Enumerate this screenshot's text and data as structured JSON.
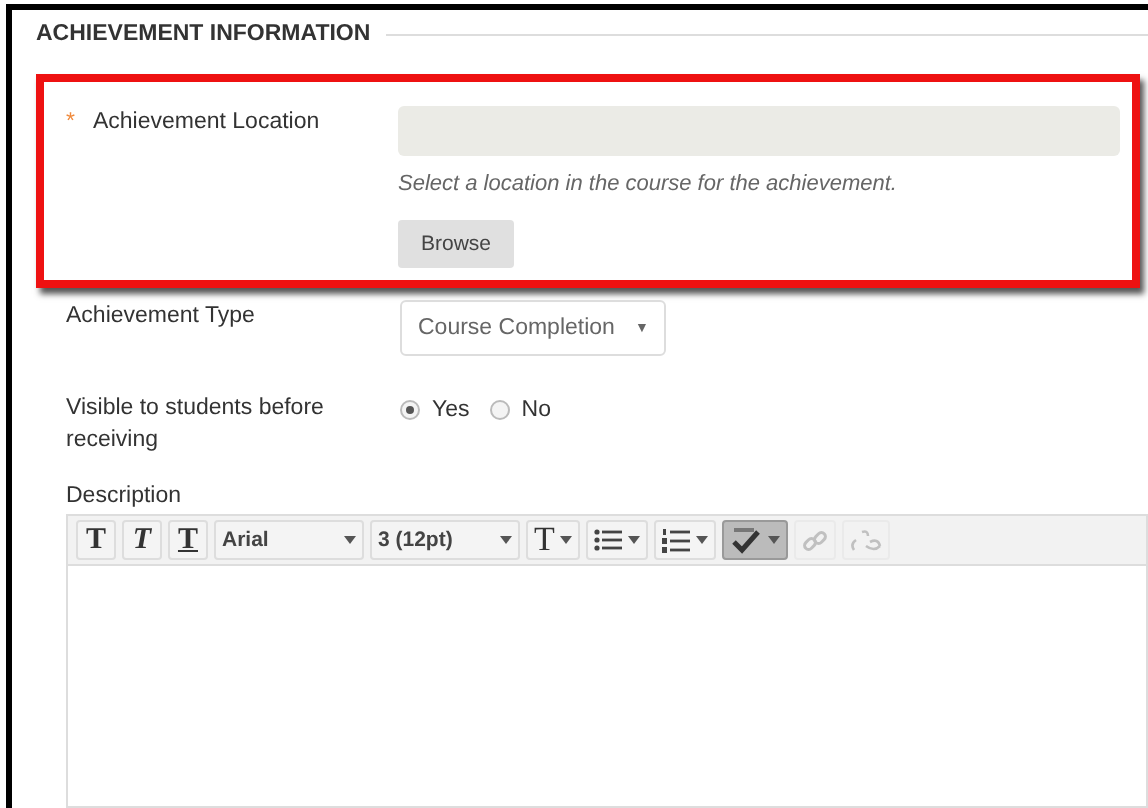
{
  "section": {
    "title": "ACHIEVEMENT INFORMATION"
  },
  "location": {
    "required_mark": "*",
    "label": "Achievement Location",
    "hint": "Select a location in the course for the achievement.",
    "button": "Browse",
    "highlighted": true
  },
  "type": {
    "label": "Achievement Type",
    "value": "Course Completion",
    "arrow": "▼"
  },
  "visible": {
    "label": "Visible to students before receiving",
    "options": [
      {
        "label": "Yes",
        "selected": true
      },
      {
        "label": "No",
        "selected": false
      }
    ]
  },
  "description": {
    "label": "Description",
    "toolbar": [
      {
        "kind": "bold",
        "label": "T",
        "pressed": false,
        "disabled": false
      },
      {
        "kind": "italic",
        "label": "T",
        "pressed": false,
        "disabled": false
      },
      {
        "kind": "underline",
        "label": "T",
        "pressed": false,
        "disabled": false
      },
      {
        "kind": "select",
        "label": "Arial",
        "pressed": false,
        "disabled": false
      },
      {
        "kind": "select",
        "label": "3 (12pt)",
        "pressed": false,
        "disabled": false
      },
      {
        "kind": "text-color",
        "label": "T",
        "pressed": false,
        "disabled": false
      },
      {
        "kind": "bullets",
        "pressed": false,
        "disabled": false
      },
      {
        "kind": "numbering",
        "pressed": false,
        "disabled": false
      },
      {
        "kind": "spellcheck",
        "pressed": true,
        "disabled": false
      },
      {
        "kind": "link",
        "pressed": false,
        "disabled": true
      },
      {
        "kind": "unlink",
        "pressed": false,
        "disabled": true
      }
    ]
  }
}
